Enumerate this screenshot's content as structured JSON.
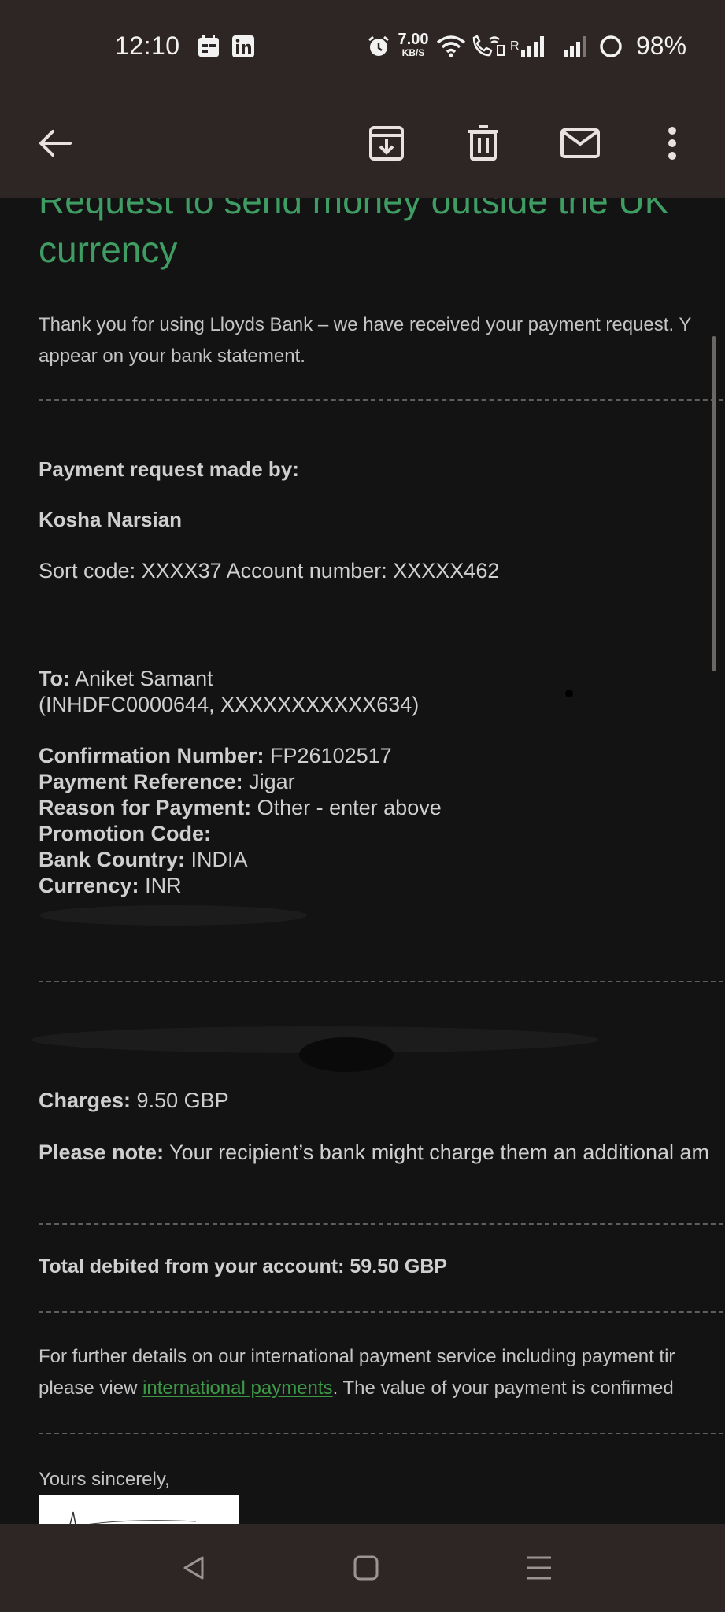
{
  "status_bar": {
    "time": "12:10",
    "net_speed_value": "7.00",
    "net_speed_unit": "KB/S",
    "roaming_indicator": "R",
    "battery_percent": "98%",
    "icons": [
      "calendar-notification-icon",
      "linkedin-icon",
      "alarm-icon",
      "wifi-icon",
      "wifi-calling-icon",
      "signal-icon",
      "battery-icon"
    ]
  },
  "toolbar": {
    "icons": [
      "back-arrow-icon",
      "archive-icon",
      "delete-icon",
      "mark-unread-icon",
      "more-options-icon"
    ]
  },
  "email": {
    "title_line1": "Request to send money outside the UK",
    "title_line2": "currency",
    "intro_line1": "Thank you for using Lloyds Bank – we have received your payment request. Y",
    "intro_line2": "appear on your bank statement.",
    "requester_heading": "Payment request made by:",
    "requester_name": "Kosha Narsian",
    "requester_account": "Sort code: XXXX37 Account number: XXXXX462",
    "to_label": "To:",
    "to_value": "Aniket Samant",
    "to_detail": "(INHDFC0000644, XXXXXXXXXXX634)",
    "details": [
      {
        "label": "Confirmation Number:",
        "value": "FP26102517"
      },
      {
        "label": "Payment Reference:",
        "value": "Jigar"
      },
      {
        "label": "Reason for Payment:",
        "value": "Other - enter above"
      },
      {
        "label": "Promotion Code:",
        "value": ""
      },
      {
        "label": "Bank Country:",
        "value": "INDIA"
      },
      {
        "label": "Currency:",
        "value": "INR"
      }
    ],
    "charges_label": "Charges:",
    "charges_value": "9.50 GBP",
    "note_label": "Please note:",
    "note_value": "Your recipient’s bank might charge them an additional am",
    "total": "Total debited from your account: 59.50 GBP",
    "further_line1": "For further details on our international payment service including payment tir",
    "further_prefix": "please view ",
    "further_link": "international payments",
    "further_suffix": ". The value of your payment is confirmed",
    "sign_off": "Yours sincerely,"
  },
  "nav_bar": {
    "icons": [
      "back-triangle-icon",
      "home-square-icon",
      "recents-menu-icon"
    ]
  },
  "colors": {
    "bars": "#2e2624",
    "background": "#131313",
    "title_green": "#3f9d63",
    "link_green": "#3c9a47"
  }
}
